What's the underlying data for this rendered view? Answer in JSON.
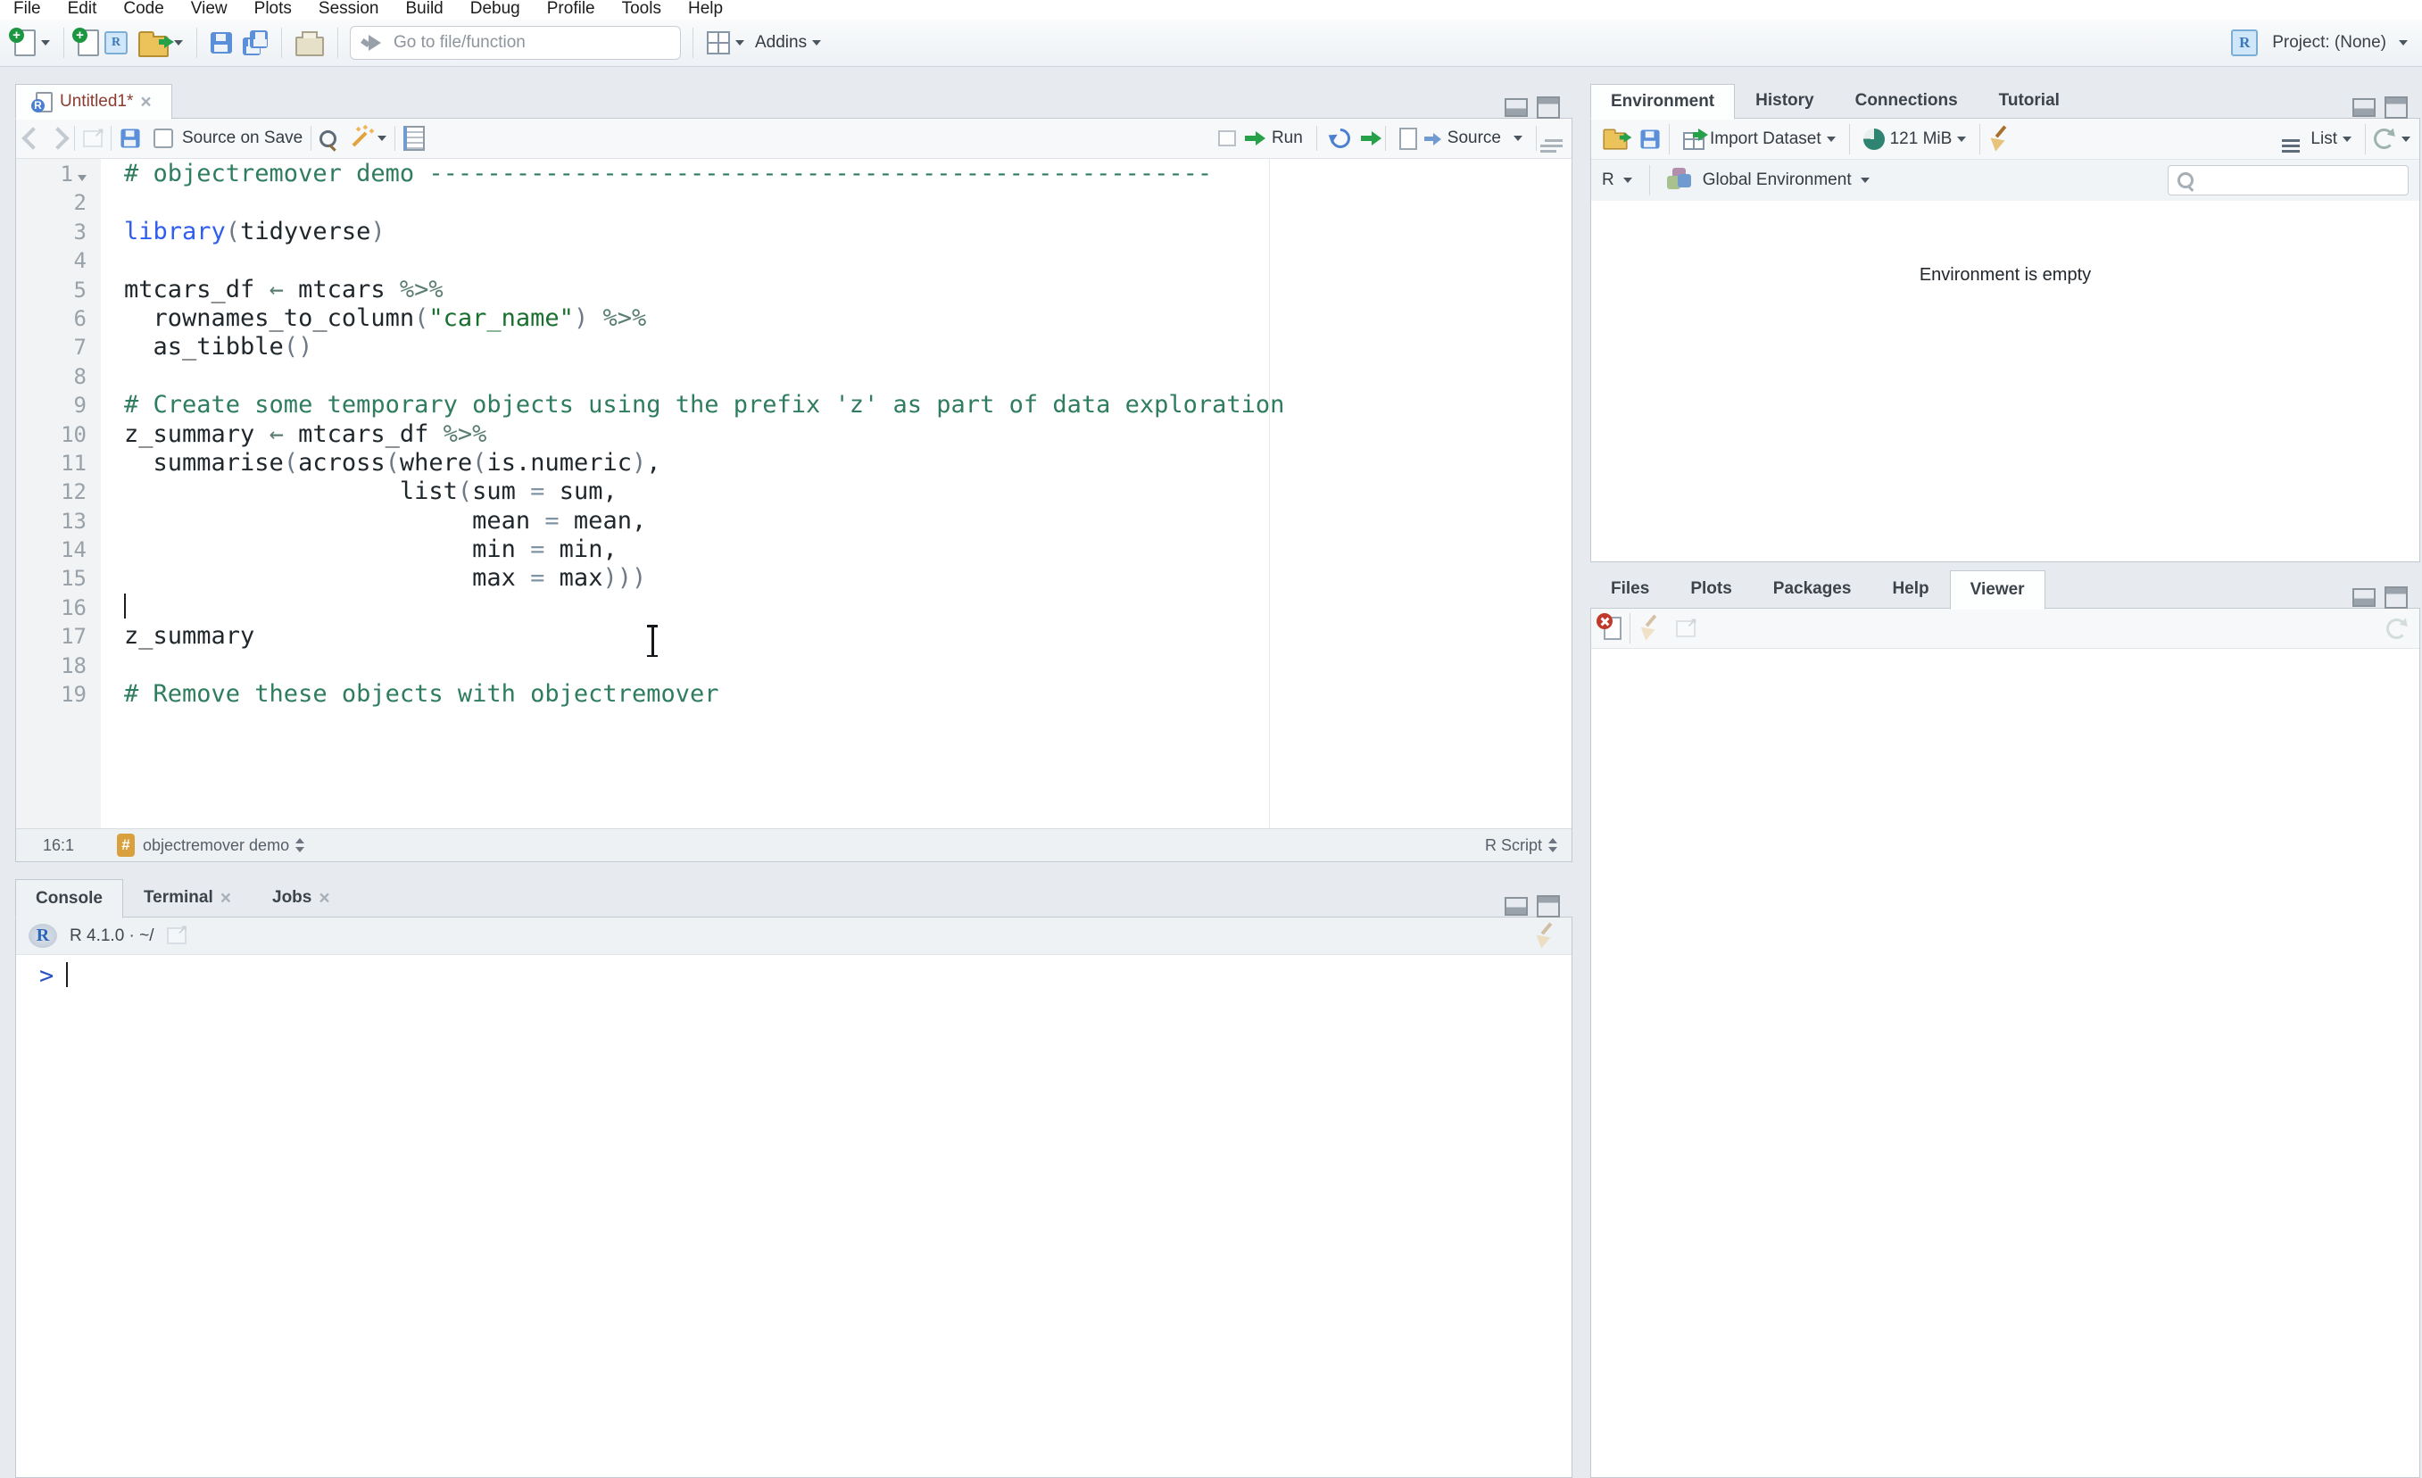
{
  "window": {
    "project_label": "Project: (None)"
  },
  "menu": {
    "items": [
      "File",
      "Edit",
      "Code",
      "View",
      "Plots",
      "Session",
      "Build",
      "Debug",
      "Profile",
      "Tools",
      "Help"
    ]
  },
  "toolbar": {
    "goto_placeholder": "Go to file/function",
    "addins_label": "Addins"
  },
  "glyphs": {
    "close": "×",
    "popout_arrow": "↗",
    "r_logo": "R",
    "plus": "+",
    "prompt": ">"
  },
  "editor": {
    "tab": {
      "title": "Untitled1*"
    },
    "toolbar": {
      "source_on_save": "Source on Save",
      "run_label": "Run",
      "source_label": "Source"
    },
    "status": {
      "position": "16:1",
      "section": "objectremover demo",
      "file_type": "R Script"
    },
    "code": {
      "lines": [
        {
          "n": 1,
          "fold": true,
          "tokens": [
            {
              "c": "cm",
              "t": "# objectremover demo ------------------------------------------------------"
            }
          ]
        },
        {
          "n": 2,
          "tokens": []
        },
        {
          "n": 3,
          "tokens": [
            {
              "c": "kw",
              "t": "library"
            },
            {
              "c": "pr",
              "t": "("
            },
            {
              "c": "tx",
              "t": "tidyverse"
            },
            {
              "c": "pr",
              "t": ")"
            }
          ]
        },
        {
          "n": 4,
          "tokens": []
        },
        {
          "n": 5,
          "tokens": [
            {
              "c": "tx",
              "t": "mtcars_df "
            },
            {
              "c": "op",
              "t": "←"
            },
            {
              "c": "tx",
              "t": " mtcars "
            },
            {
              "c": "op",
              "t": "%>%"
            }
          ]
        },
        {
          "n": 6,
          "tokens": [
            {
              "c": "tx",
              "t": "  rownames_to_column"
            },
            {
              "c": "pr",
              "t": "("
            },
            {
              "c": "st",
              "t": "\"car_name\""
            },
            {
              "c": "pr",
              "t": ")"
            },
            {
              "c": "tx",
              "t": " "
            },
            {
              "c": "op",
              "t": "%>%"
            }
          ]
        },
        {
          "n": 7,
          "tokens": [
            {
              "c": "tx",
              "t": "  as_tibble"
            },
            {
              "c": "pr",
              "t": "()"
            }
          ]
        },
        {
          "n": 8,
          "tokens": []
        },
        {
          "n": 9,
          "tokens": [
            {
              "c": "cm",
              "t": "# Create some temporary objects using the prefix 'z' as part of data exploration"
            }
          ]
        },
        {
          "n": 10,
          "tokens": [
            {
              "c": "tx",
              "t": "z_summary "
            },
            {
              "c": "op",
              "t": "←"
            },
            {
              "c": "tx",
              "t": " mtcars_df "
            },
            {
              "c": "op",
              "t": "%>%"
            }
          ]
        },
        {
          "n": 11,
          "tokens": [
            {
              "c": "tx",
              "t": "  summarise"
            },
            {
              "c": "pr",
              "t": "("
            },
            {
              "c": "tx",
              "t": "across"
            },
            {
              "c": "pr",
              "t": "("
            },
            {
              "c": "tx",
              "t": "where"
            },
            {
              "c": "pr",
              "t": "("
            },
            {
              "c": "tx",
              "t": "is.numeric"
            },
            {
              "c": "pr",
              "t": ")"
            },
            {
              "c": "tx",
              "t": ","
            }
          ]
        },
        {
          "n": 12,
          "tokens": [
            {
              "c": "tx",
              "t": "                   list"
            },
            {
              "c": "pr",
              "t": "("
            },
            {
              "c": "tx",
              "t": "sum "
            },
            {
              "c": "eq",
              "t": "="
            },
            {
              "c": "tx",
              "t": " sum,"
            }
          ]
        },
        {
          "n": 13,
          "tokens": [
            {
              "c": "tx",
              "t": "                        mean "
            },
            {
              "c": "eq",
              "t": "="
            },
            {
              "c": "tx",
              "t": " mean,"
            }
          ]
        },
        {
          "n": 14,
          "tokens": [
            {
              "c": "tx",
              "t": "                        min "
            },
            {
              "c": "eq",
              "t": "="
            },
            {
              "c": "tx",
              "t": " min,"
            }
          ]
        },
        {
          "n": 15,
          "tokens": [
            {
              "c": "tx",
              "t": "                        max "
            },
            {
              "c": "eq",
              "t": "="
            },
            {
              "c": "tx",
              "t": " max"
            },
            {
              "c": "pr",
              "t": ")))"
            }
          ]
        },
        {
          "n": 16,
          "cursor": true,
          "tokens": []
        },
        {
          "n": 17,
          "tokens": [
            {
              "c": "tx",
              "t": "z_summary"
            }
          ]
        },
        {
          "n": 18,
          "tokens": []
        },
        {
          "n": 19,
          "tokens": [
            {
              "c": "cm",
              "t": "# Remove these objects with objectremover"
            }
          ]
        }
      ]
    }
  },
  "console": {
    "tabs": [
      {
        "label": "Console",
        "closable": false
      },
      {
        "label": "Terminal",
        "closable": true
      },
      {
        "label": "Jobs",
        "closable": true
      }
    ],
    "active_index": 0,
    "header_title": "R 4.1.0  ·  ~/",
    "prompt": ">"
  },
  "environment_pane": {
    "tabs": [
      "Environment",
      "History",
      "Connections",
      "Tutorial"
    ],
    "active_index": 0,
    "toolbar": {
      "import_label": "Import Dataset",
      "memory_label": "121 MiB",
      "list_label": "List"
    },
    "scope": {
      "language": "R",
      "environment": "Global Environment"
    },
    "empty_message": "Environment is empty",
    "search_placeholder": ""
  },
  "files_pane": {
    "tabs": [
      "Files",
      "Plots",
      "Packages",
      "Help",
      "Viewer"
    ],
    "active_index": 4
  },
  "colors": {
    "window_bg": "#e7ebf0",
    "keyword_blue": "#2e5df0",
    "comment_green": "#2f7d5f",
    "string_green": "#19702f",
    "operator_teal": "#5a7d72",
    "tab_title_red": "#8d3b2f",
    "run_green": "#27a04a",
    "badge_orange": "#d9a13d",
    "prompt_blue": "#2653c9"
  }
}
